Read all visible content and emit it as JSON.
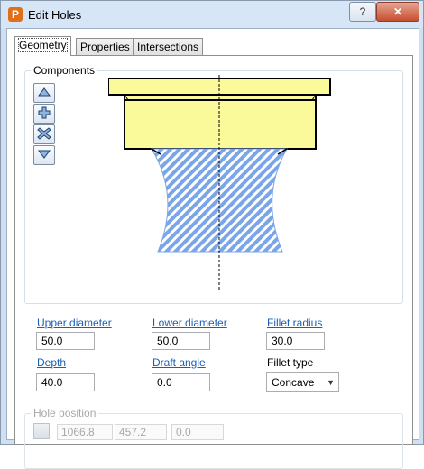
{
  "window": {
    "title": "Edit Holes",
    "app_icon_letter": "P",
    "help_label": "?",
    "close_label": "✕"
  },
  "tabs": [
    {
      "label": "Geometry",
      "active": true
    },
    {
      "label": "Properties",
      "active": false
    },
    {
      "label": "Intersections",
      "active": false
    }
  ],
  "components": {
    "legend": "Components",
    "buttons": [
      "move-up",
      "add",
      "delete",
      "move-down"
    ]
  },
  "fields": {
    "upper_diameter": {
      "label": "Upper diameter",
      "value": "50.0"
    },
    "lower_diameter": {
      "label": "Lower diameter",
      "value": "50.0"
    },
    "fillet_radius": {
      "label": "Fillet radius",
      "value": "30.0"
    },
    "depth": {
      "label": "Depth",
      "value": "40.0"
    },
    "draft_angle": {
      "label": "Draft angle",
      "value": "0.0"
    },
    "fillet_type": {
      "label": "Fillet type",
      "value": "Concave"
    }
  },
  "hole_position": {
    "legend": "Hole position",
    "x": "1066.8",
    "y": "457.2",
    "z": "0.0"
  },
  "colors": {
    "link": "#1a5fb4",
    "component_fill": "#fafa9a",
    "hatch_blue": "#7aa5e8"
  }
}
